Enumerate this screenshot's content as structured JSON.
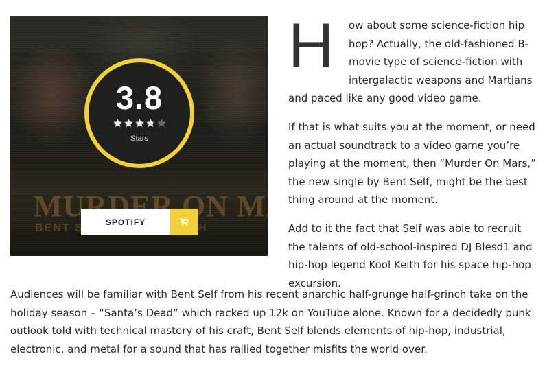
{
  "review": {
    "score": "3.8",
    "stars_filled": 3.8,
    "stars_max": 5,
    "rating_label": "Stars",
    "cover_title": "MURDER ON MARS",
    "cover_credits": "BENT SELF & KOOL KEITH",
    "colors": {
      "accent": "#f2d03a",
      "star": "#e6e6e6",
      "star_empty": "#6a6a6a"
    }
  },
  "buttons": {
    "spotify_label": "SPOTIFY",
    "spotify_icon": "shopping-cart-icon"
  },
  "article": {
    "drop_cap": "H",
    "p1_rest": "ow about some science-fiction hip hop? Actually, the old-fashioned B-movie type of science-fiction with intergalactic weapons and Martians and paced like any good video game.",
    "p2": "If that is what suits you at the moment, or need an actual soundtrack to a video game you’re playing at the moment, then “Murder On Mars,” the new single by Bent Self, might be the best thing around at the moment.",
    "p3": "Add to it the fact that Self was able to recruit the talents of old-school-inspired DJ Blesd1 and hip-hop legend Kool Keith for his space hip-hop excursion.",
    "p4": "Audiences will be familiar with Bent Self from his recent anarchic half-grunge half-grinch take on the holiday season – “Santa’s Dead” which racked up 12k on YouTube alone. Known for a decidedly punk outlook told with technical mastery of his craft, Bent Self blends elements of hip-hop, industrial, electronic, and metal for a sound that has rallied together misfits the world over."
  }
}
